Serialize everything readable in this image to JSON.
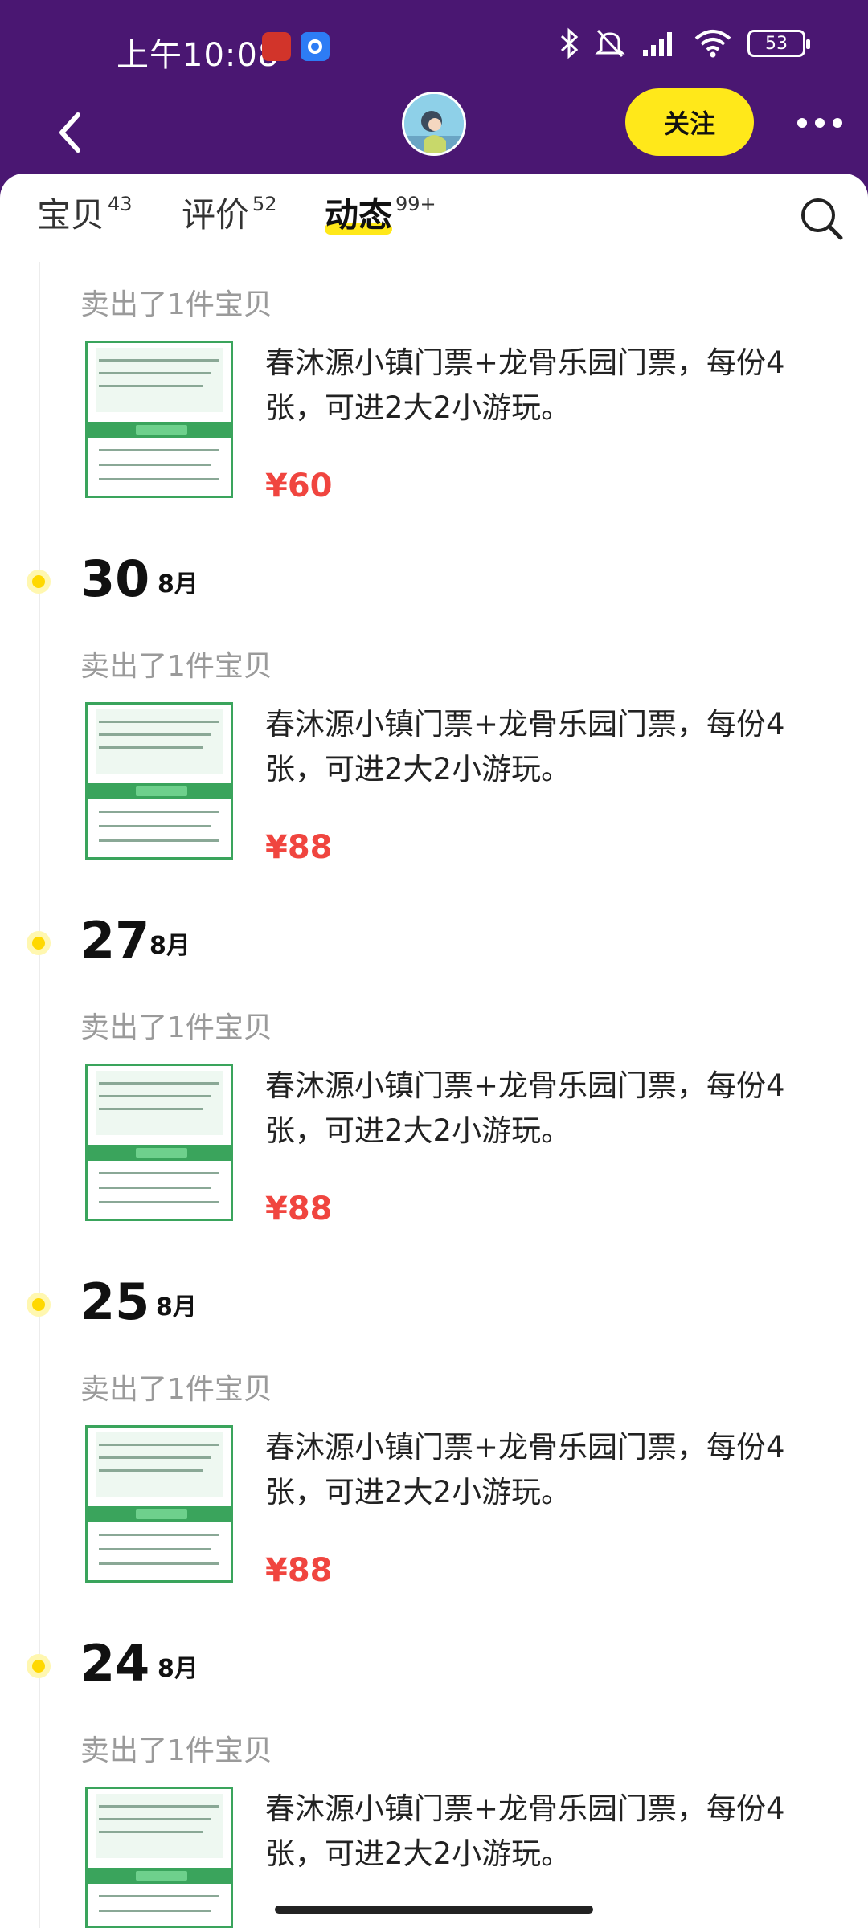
{
  "status_bar": {
    "time": "上午10:08",
    "battery": "53"
  },
  "header": {
    "follow_label": "关注"
  },
  "tabs": [
    {
      "label": "宝贝",
      "count": "43"
    },
    {
      "label": "评价",
      "count": "52"
    },
    {
      "label": "动态",
      "count": "99+"
    }
  ],
  "feed": {
    "entries": [
      {
        "sold_label": "卖出了1件宝贝",
        "title": "春沐源小镇门票+龙骨乐园门票，每份4张，可进2大2小游玩。",
        "price": "¥60"
      },
      {
        "date_day": "30",
        "date_month": "8月",
        "sold_label": "卖出了1件宝贝",
        "title": "春沐源小镇门票+龙骨乐园门票，每份4张，可进2大2小游玩。",
        "price": "¥88"
      },
      {
        "date_day": "27",
        "date_month": "8月",
        "sold_label": "卖出了1件宝贝",
        "title": "春沐源小镇门票+龙骨乐园门票，每份4张，可进2大2小游玩。",
        "price": "¥88"
      },
      {
        "date_day": "25",
        "date_month": "8月",
        "sold_label": "卖出了1件宝贝",
        "title": "春沐源小镇门票+龙骨乐园门票，每份4张，可进2大2小游玩。",
        "price": "¥88"
      },
      {
        "date_day": "24",
        "date_month": "8月",
        "sold_label": "卖出了1件宝贝",
        "title": "春沐源小镇门票+龙骨乐园门票，每份4张，可进2大2小游玩。"
      }
    ]
  },
  "colors": {
    "header_bg": "#4a1772",
    "accent_yellow": "#ffe81a",
    "price_red": "#f0453f",
    "thumb_green": "#3aa45c"
  },
  "icons": [
    "back-arrow-icon",
    "more-dots-icon",
    "search-icon",
    "bluetooth-icon",
    "mute-icon",
    "signal-icon",
    "wifi-icon",
    "battery-icon"
  ]
}
